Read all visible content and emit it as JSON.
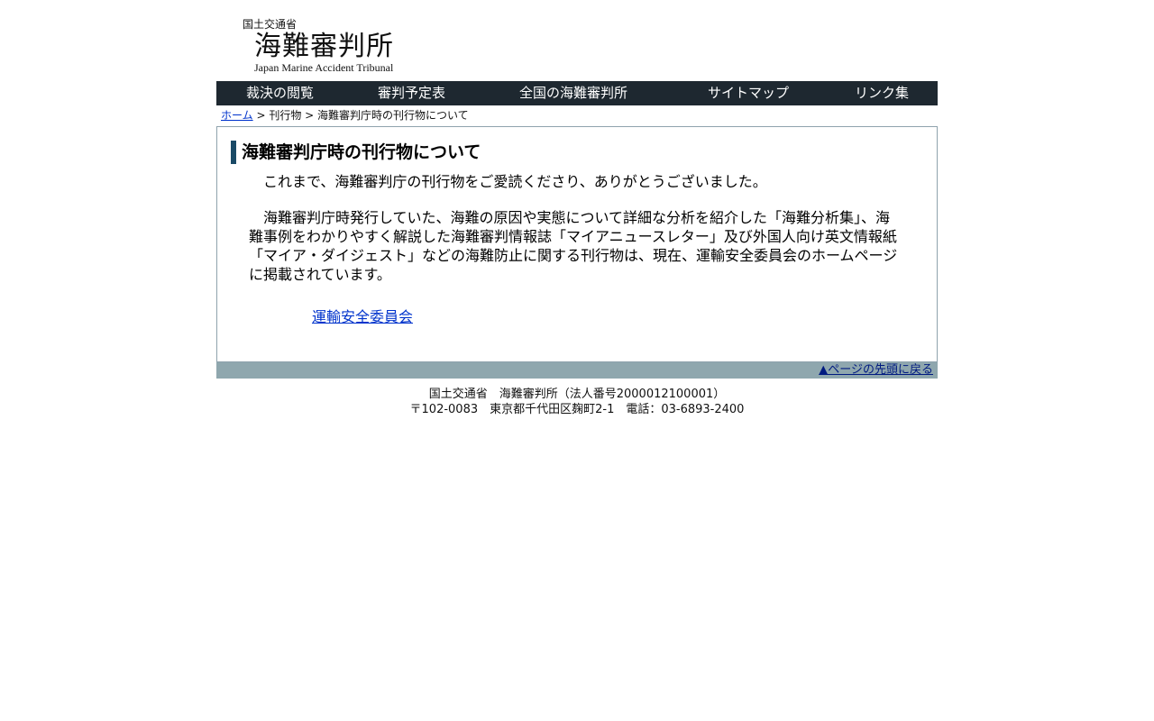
{
  "header": {
    "ministry": "国土交通省",
    "title": "海難審判所",
    "subtitle_en": "Japan Marine Accident Tribunal"
  },
  "nav": {
    "items": [
      {
        "label": "裁決の閲覧"
      },
      {
        "label": "審判予定表"
      },
      {
        "label": "全国の海難審判所"
      },
      {
        "label": "サイトマップ"
      },
      {
        "label": "リンク集"
      }
    ]
  },
  "breadcrumb": {
    "home": "ホーム",
    "sep1": " > ",
    "level1": "刊行物",
    "sep2": " > ",
    "current": "海難審判庁時の刊行物について"
  },
  "main": {
    "heading": "海難審判庁時の刊行物について",
    "paragraph1": "これまで、海難審判庁の刊行物をご愛読くださり、ありがとうございました。",
    "paragraph2": "海難審判庁時発行していた、海難の原因や実態について詳細な分析を紹介した「海難分析集」、海難事例をわかりやすく解説した海難審判情報誌「マイアニュースレター」及び外国人向け英文情報紙「マイア・ダイジェスト」などの海難防止に関する刊行物は、現在、運輸安全委員会のホームページに掲載されています。",
    "link_label": "運輸安全委員会"
  },
  "pagetop": {
    "label": "▲ページの先頭に戻る"
  },
  "footer": {
    "line1": "国土交通省　海難審判所（法人番号2000012100001）",
    "line2": "〒102-0083　東京都千代田区麹町2-1　電話：03-6893-2400"
  },
  "colors": {
    "nav_bg": "#1e2830",
    "pagetop_bg": "#8fa7ae",
    "heading_accent": "#1a4a66",
    "link": "#0033cc"
  }
}
